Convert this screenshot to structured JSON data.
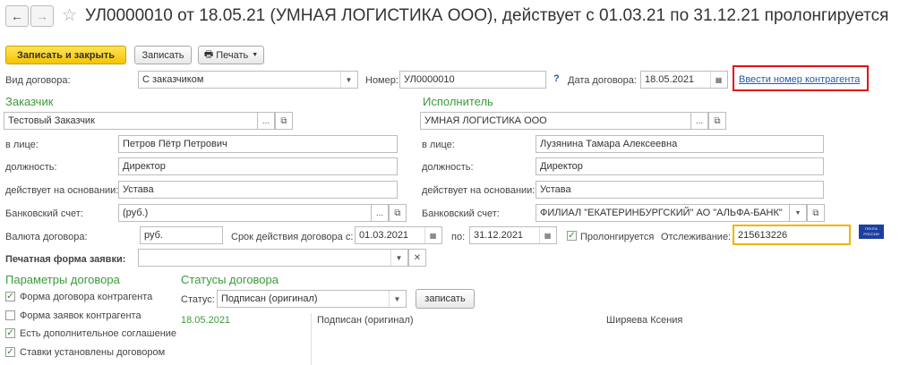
{
  "header": {
    "title": "УЛ0000010 от 18.05.21 (УМНАЯ ЛОГИСТИКА ООО), действует с 01.03.21 по 31.12.21 пролонгируется"
  },
  "toolbar": {
    "save_close": "Записать и закрыть",
    "save": "Записать",
    "print": "Печать"
  },
  "top": {
    "contract_type_label": "Вид договора:",
    "contract_type_value": "С заказчиком",
    "number_label": "Номер:",
    "number_value": "УЛ0000010",
    "help": "?",
    "date_label": "Дата договора:",
    "date_value": "18.05.2021",
    "counterparty_number_link": "Ввести номер контрагента"
  },
  "customer": {
    "section": "Заказчик",
    "name": "Тестовый Заказчик",
    "person_label": "в лице:",
    "person": "Петров Пётр Петрович",
    "position_label": "должность:",
    "position": "Директор",
    "basis_label": "действует на основании:",
    "basis": "Устава",
    "bank_label": "Банковский счет:",
    "bank": "(руб.)"
  },
  "contractor": {
    "section": "Исполнитель",
    "name": "УМНАЯ ЛОГИСТИКА ООО",
    "person_label": "в лице:",
    "person": "Лузянина Тамара Алексеевна",
    "position_label": "должность:",
    "position": "Директор",
    "basis_label": "действует на основании:",
    "basis": "Устава",
    "bank_label": "Банковский счет:",
    "bank": "ФИЛИАЛ \"ЕКАТЕРИНБУРГСКИЙ\" АО \"АЛЬФА-БАНК\""
  },
  "terms": {
    "currency_label": "Валюта договора:",
    "currency": "руб.",
    "validity_label": "Срок действия договора с:",
    "valid_from": "01.03.2021",
    "to_label": "по:",
    "valid_to": "31.12.2021",
    "prolong_label": "Пролонгируется",
    "prolong_checked": true,
    "tracking_label": "Отслеживание:",
    "tracking_value": "215613226",
    "post_logo": "ПОЧТА РОССИИ"
  },
  "print_form": {
    "label": "Печатная форма заявки:",
    "value": ""
  },
  "params": {
    "section": "Параметры договора",
    "items": [
      {
        "label": "Форма договора контрагента",
        "checked": true
      },
      {
        "label": "Форма заявок контрагента",
        "checked": false
      },
      {
        "label": "Есть дополнительное соглашение",
        "checked": true
      },
      {
        "label": "Ставки установлены договором",
        "checked": true
      }
    ]
  },
  "statuses": {
    "section": "Статусы договора",
    "status_label": "Статус:",
    "status_value": "Подписан (оригинал)",
    "save_button": "записать",
    "rows": [
      {
        "date": "18.05.2021",
        "status": "Подписан (оригинал)",
        "user": "Ширяева Ксения"
      }
    ]
  },
  "colors": {
    "primary_button": "#f5c400",
    "section_green": "#3a9b3a",
    "highlight_red": "#e0101a",
    "focus_yellow": "#f0b400",
    "link_blue": "#1f5ab5"
  }
}
